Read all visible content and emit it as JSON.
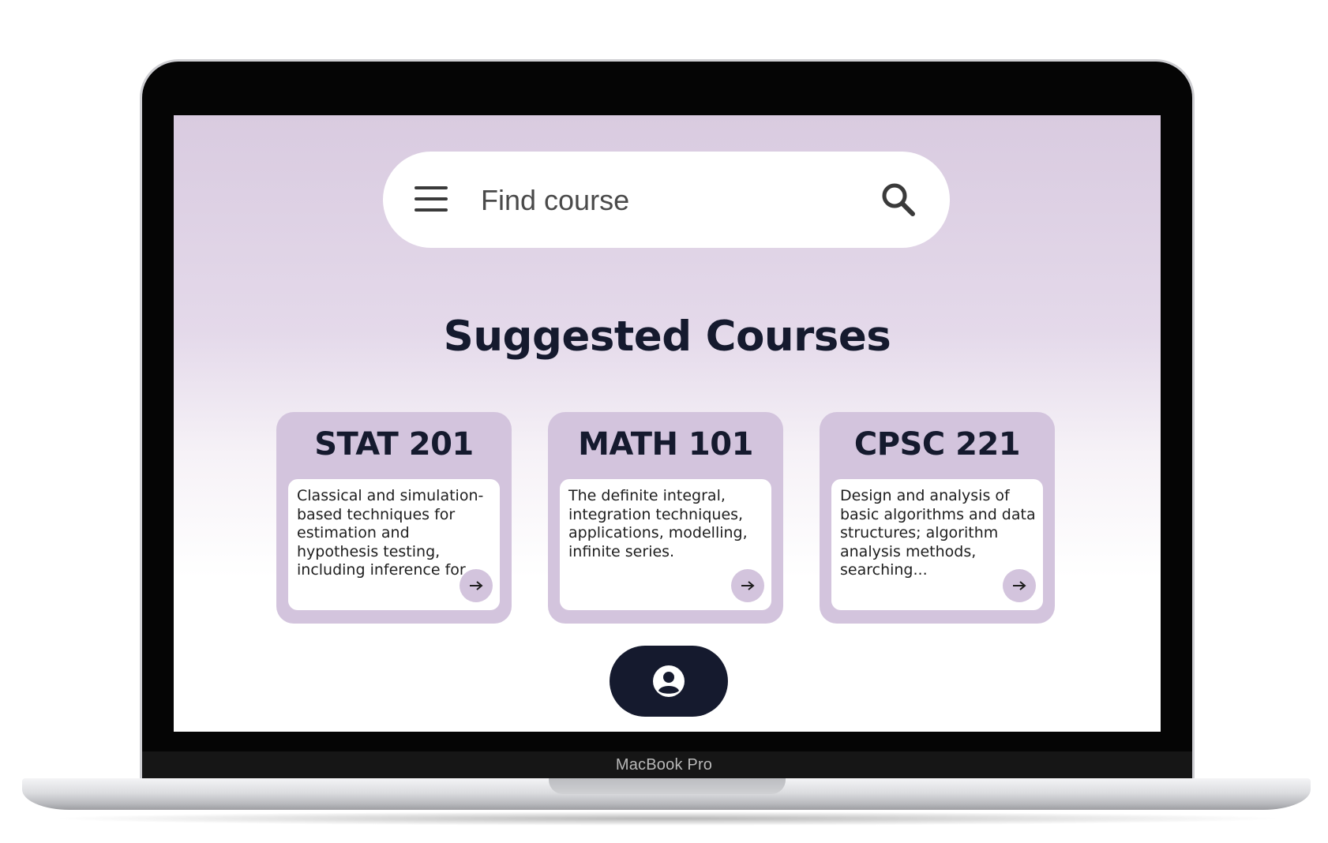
{
  "device": {
    "brand_label": "MacBook Pro"
  },
  "search": {
    "placeholder": "Find course",
    "menu_icon": "hamburger-menu-icon",
    "search_icon": "magnifier-icon"
  },
  "main": {
    "title": "Suggested Courses"
  },
  "courses": [
    {
      "code": "STAT 201",
      "description": "Classical and simulation-based techniques for estimation and hypothesis testing, including inference for...",
      "action_icon": "arrow-right-icon"
    },
    {
      "code": "MATH 101",
      "description": "The definite integral, integration techniques, applications, modelling, infinite series.",
      "action_icon": "arrow-right-icon"
    },
    {
      "code": "CPSC 221",
      "description": "Design and analysis of basic algorithms and data structures; algorithm analysis methods, searching...",
      "action_icon": "arrow-right-icon"
    }
  ],
  "footer": {
    "profile_icon": "user-account-icon"
  },
  "colors": {
    "card_bg": "#d3c4dd",
    "dark_navy": "#151a2e",
    "screen_top": "#d9cbe0",
    "screen_bottom": "#ffffff"
  }
}
